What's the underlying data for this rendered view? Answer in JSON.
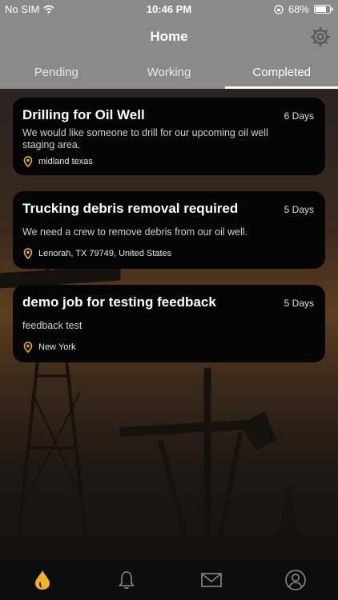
{
  "status_bar": {
    "carrier": "No SIM",
    "time": "10:46 PM",
    "battery": "68%"
  },
  "header": {
    "title": "Home"
  },
  "tabs": [
    {
      "label": "Pending",
      "active": false
    },
    {
      "label": "Working",
      "active": false
    },
    {
      "label": "Completed",
      "active": true
    }
  ],
  "jobs": [
    {
      "title": "Drilling for Oil Well",
      "days": "6 Days",
      "description": "We would like someone to drill for our upcoming oil well staging area.",
      "location": "midland texas"
    },
    {
      "title": "Trucking debris removal required",
      "days": "5 Days",
      "description": "We need a crew to remove debris from our oil well.",
      "location": "Lenorah, TX  79749, United States"
    },
    {
      "title": "demo job for testing feedback",
      "days": "5 Days",
      "description": "feedback test",
      "location": "New York"
    }
  ],
  "bottom_tabs": [
    "home-drop-icon",
    "bell-icon",
    "mail-icon",
    "profile-icon"
  ],
  "colors": {
    "accent": "#f0b323",
    "header_bg": "#8a8a8a",
    "card_bg": "#050505"
  }
}
